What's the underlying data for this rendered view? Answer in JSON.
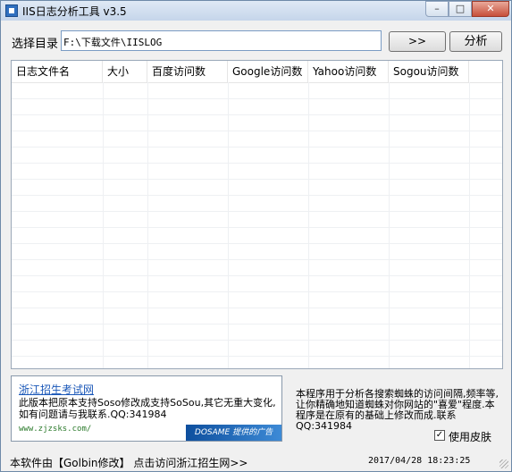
{
  "window": {
    "title": "IIS日志分析工具 v3.5",
    "minimize_glyph": "–",
    "maximize_glyph": "□",
    "close_glyph": "✕"
  },
  "toolbar": {
    "dir_label": "选择目录",
    "dir_value": "F:\\下载文件\\IISLOG",
    "browse_label": ">>",
    "analyze_label": "分析"
  },
  "table": {
    "columns": [
      "日志文件名",
      "大小",
      "百度访问数",
      "Google访问数",
      "Yahoo访问数",
      "Sogou访问数"
    ],
    "rows": []
  },
  "ad": {
    "link": "浙江招生考试网",
    "text": "此版本把原本支持Soso修改成支持SoSou,其它无重大变化,如有问题请与我联系.QQ:341984",
    "url": "www.zjzsks.com/",
    "banner": "DOSAME 提供的广告"
  },
  "description": "本程序用于分析各搜索蜘蛛的访问间隔,频率等,让你精确地知道蜘蛛对你网站的\"喜爱\"程度.本程序是在原有的基础上修改而成.联系QQ:341984",
  "skin": {
    "label": "使用皮肤",
    "checked": true,
    "check_glyph": "✓"
  },
  "status": {
    "left": "本软件由【Golbin修改】 点击访问浙江招生网>>",
    "time": "2017/04/28 18:23:25"
  }
}
